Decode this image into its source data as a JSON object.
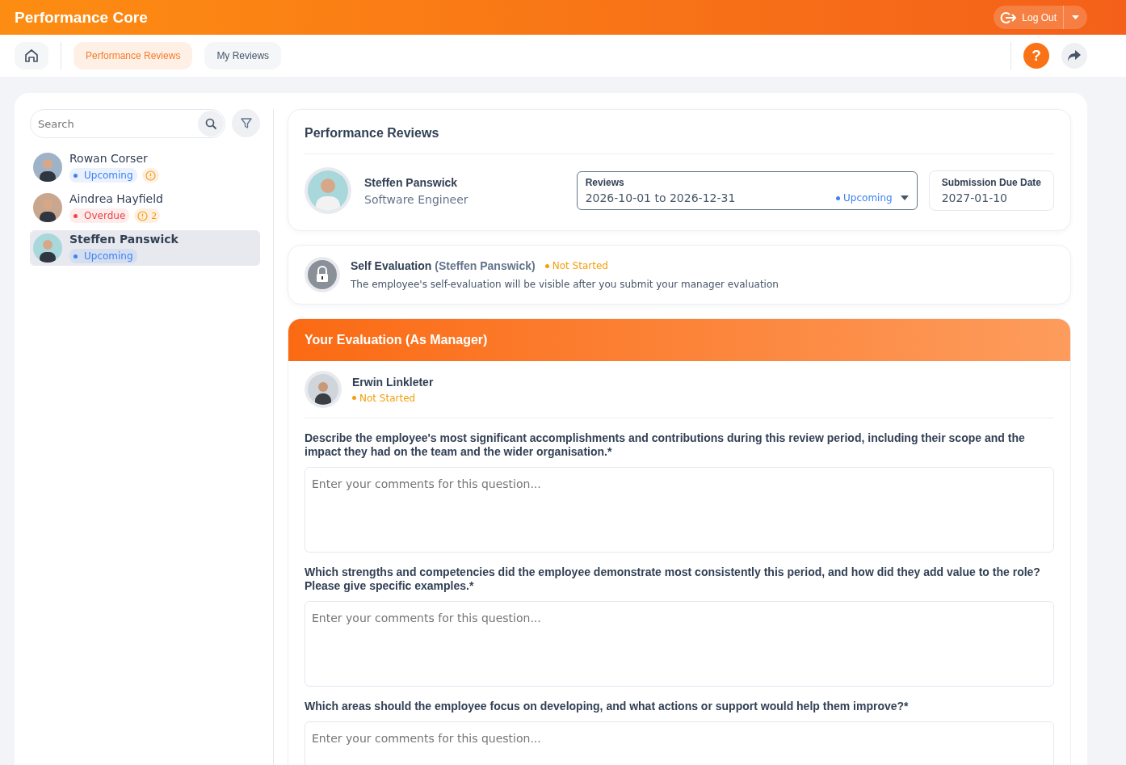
{
  "app": {
    "title": "Performance Core",
    "logout": "Log Out"
  },
  "nav": {
    "tabs": [
      {
        "label": "Performance Reviews",
        "selected": true
      },
      {
        "label": "My Reviews",
        "selected": false
      }
    ],
    "help": "?"
  },
  "sidebar": {
    "search": {
      "placeholder": "Search"
    },
    "employees": [
      {
        "name": "Rowan Corser",
        "status": "Upcoming",
        "color": "#3b82f6",
        "alert": true,
        "selected": false
      },
      {
        "name": "Aindrea Hayfield",
        "status": "Overdue",
        "color": "#ef4444",
        "alert": true,
        "alert_count": "2",
        "selected": false
      },
      {
        "name": "Steffen Panswick",
        "status": "Upcoming",
        "color": "#3b82f6",
        "alert": false,
        "selected": true
      }
    ]
  },
  "review": {
    "title": "Performance Reviews",
    "employee": {
      "name": "Steffen Panswick",
      "role": "Software Engineer"
    },
    "period": {
      "label": "Reviews",
      "value": "2026-10-01 to 2026-12-31",
      "status": "Upcoming",
      "color": "#3b82f6"
    },
    "due": {
      "label": "Submission Due Date",
      "value": "2027-01-10"
    }
  },
  "self_evaluation": {
    "title": "Self Evaluation",
    "person": "(Steffen Panswick)",
    "status": "Not Started",
    "color": "#f59e0b",
    "note": "The employee's self-evaluation will be visible after you submit your manager evaluation"
  },
  "manager_evaluation": {
    "title": "Your Evaluation (As Manager)",
    "manager": "Erwin Linkleter",
    "status": "Not Started",
    "color": "#f59e0b",
    "questions": [
      {
        "text": "Describe the employee's most significant accomplishments and contributions during this review period, including their scope and the impact they had on the team and the wider organisation.*",
        "placeholder": "Enter your comments for this question..."
      },
      {
        "text": "Which strengths and competencies did the employee demonstrate most consistently this period, and how did they add value to the role? Please give specific examples.*",
        "placeholder": "Enter your comments for this question..."
      },
      {
        "text": "Which areas should the employee focus on developing, and what actions or support would help them improve?*",
        "placeholder": "Enter your comments for this question..."
      }
    ]
  }
}
